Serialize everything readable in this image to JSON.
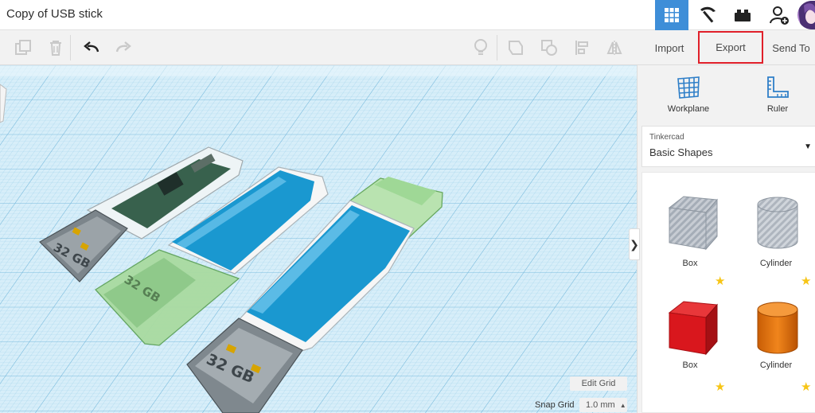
{
  "app": {
    "title": "Copy of USB stick"
  },
  "topbar": {
    "icons": [
      "grid-view-icon",
      "pickaxe-icon",
      "brick-icon",
      "add-user-icon"
    ],
    "active_color": "#3e8ed8"
  },
  "toolbar": {
    "import_label": "Import",
    "export_label": "Export",
    "sendto_label": "Send To",
    "highlight_color": "#e0202a"
  },
  "workspace": {
    "edit_grid_label": "Edit Grid",
    "snap_grid_label": "Snap Grid",
    "snap_grid_value": "1.0 mm",
    "objects": [
      {
        "name": "usb-stick-clear",
        "label": "32 GB"
      },
      {
        "name": "usb-stick-blue-green",
        "label": "32 GB"
      },
      {
        "name": "usb-stick-green-blue",
        "label": "32 GB"
      }
    ],
    "grid_color": "#8ec9e6"
  },
  "panel": {
    "workplane_label": "Workplane",
    "ruler_label": "Ruler",
    "library_source": "Tinkercad",
    "library_name": "Basic Shapes",
    "shapes": [
      {
        "label": "Box",
        "style": "hole",
        "color": "#b5bcc6"
      },
      {
        "label": "Cylinder",
        "style": "hole",
        "color": "#c6ccd3"
      },
      {
        "label": "Box",
        "style": "solid",
        "color": "#d9171d"
      },
      {
        "label": "Cylinder",
        "style": "solid",
        "color": "#f07a12"
      }
    ]
  }
}
